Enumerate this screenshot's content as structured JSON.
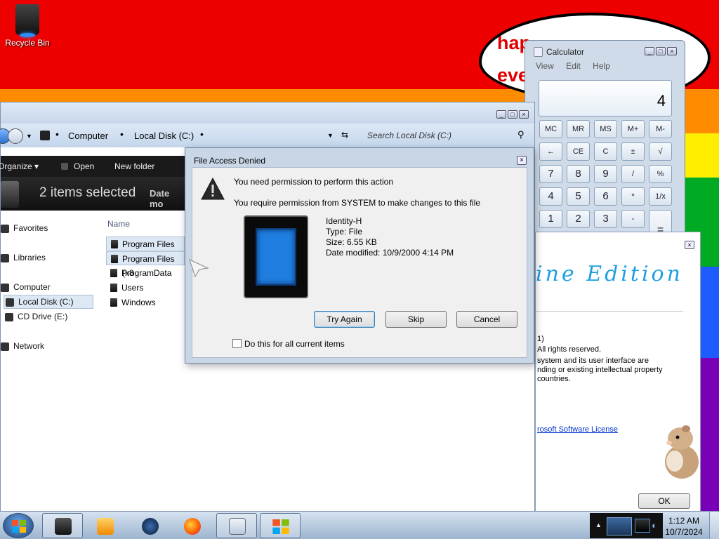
{
  "desktop": {
    "recycle_bin_label": "Recycle Bin",
    "bubble_line1": "hap",
    "bubble_line2": "eve"
  },
  "calculator": {
    "title": "Calculator",
    "menu": [
      "View",
      "Edit",
      "Help"
    ],
    "display": "4",
    "buttons": [
      [
        "MC",
        "MR",
        "MS",
        "M+",
        "M-"
      ],
      [
        "←",
        "CE",
        "C",
        "±",
        "√"
      ],
      [
        "7",
        "8",
        "9",
        "/",
        "%"
      ],
      [
        "4",
        "5",
        "6",
        "*",
        "1/x"
      ],
      [
        "1",
        "2",
        "3",
        "-",
        "="
      ]
    ]
  },
  "explorer": {
    "breadcrumb": [
      "Computer",
      "Local Disk (C:)"
    ],
    "search_placeholder": "Search Local Disk (C:)",
    "organize": "Organize",
    "open": "Open",
    "new_folder": "New folder",
    "selection_count": "2 items selected",
    "date_label": "Date mo",
    "column_name": "Name",
    "nav": {
      "favorites": "Favorites",
      "libraries": "Libraries",
      "computer": "Computer",
      "local_disk": "Local Disk (C:)",
      "cd_drive": "CD Drive (E:)",
      "network": "Network"
    },
    "files": [
      "Program Files",
      "Program Files (x8",
      "ProgramData",
      "Users",
      "Windows"
    ]
  },
  "dialog": {
    "title": "File Access Denied",
    "heading": "You need permission to perform this action",
    "message": "You require permission from SYSTEM to make changes to this file",
    "file_name": "Identity-H",
    "file_type": "Type: File",
    "file_size": "Size: 6.55 KB",
    "file_date": "Date modified: 10/9/2000 4:14 PM",
    "try_again": "Try Again",
    "skip": "Skip",
    "cancel": "Cancel",
    "checkbox_label": "Do this for all current items"
  },
  "about": {
    "edition": "ine Edition",
    "line1": "1)",
    "line2": "All rights reserved.",
    "line3": "system and its user interface are",
    "line4": "nding or existing intellectual property",
    "line5": "countries.",
    "license_link": "rosoft Software License",
    "ok": "OK"
  },
  "taskbar": {
    "time": "1:12 AM",
    "date": "10/7/2024"
  },
  "colors": {
    "accent_blue": "#1e5cff",
    "edition_cyan": "#1ea0e0",
    "bubble_red": "#e00000"
  }
}
